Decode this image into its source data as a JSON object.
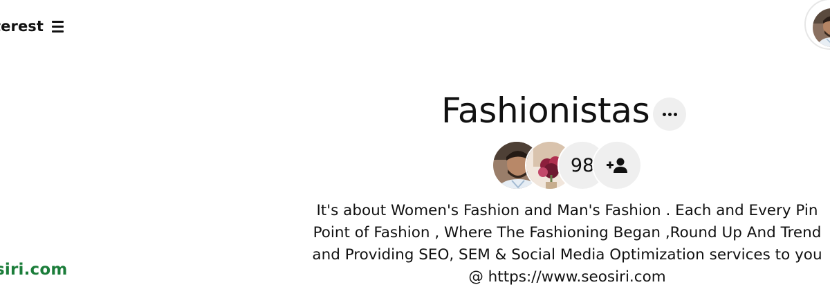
{
  "header": {
    "brand_partial": "terest",
    "menu_icon": "hamburger-menu-icon"
  },
  "user": {
    "avatar_icon": "user-avatar"
  },
  "sidebar": {
    "website_partial": "siri.com",
    "website_color": "#1b7d3a"
  },
  "board": {
    "title": "Fashionistas",
    "more_icon": "ellipsis-icon",
    "collaborators": {
      "count": "98",
      "invite_icon": "add-person-icon"
    },
    "description_lines": [
      "It's about Women's Fashion and Man's Fashion . Each and Every Pin",
      "Point of Fashion , Where The Fashioning Began ,Round Up And Trend",
      "and Providing SEO, SEM & Social Media Optimization services to you",
      "@ https://www.seosiri.com"
    ]
  },
  "colors": {
    "background": "#ffffff",
    "text": "#111111",
    "button_bg": "#efefef",
    "link_green": "#1b7d3a"
  }
}
